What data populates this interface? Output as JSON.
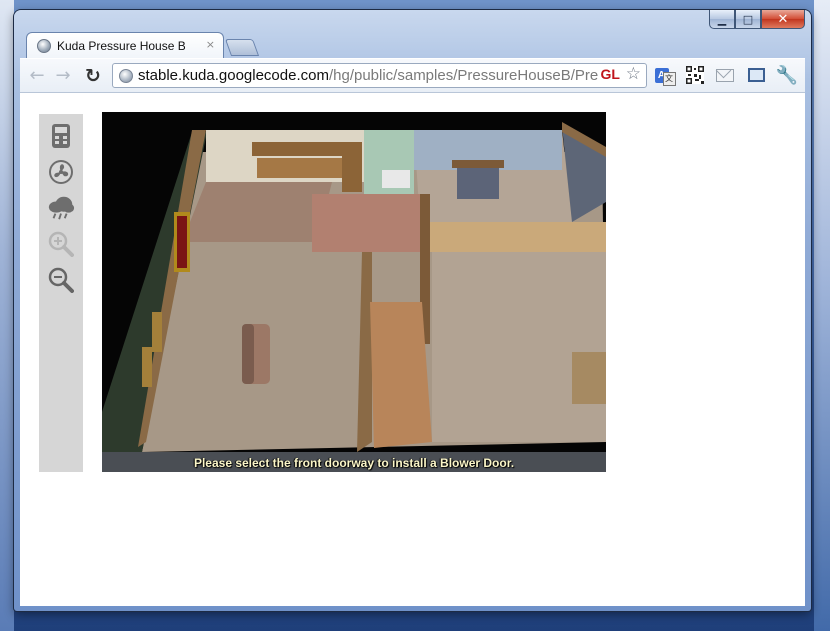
{
  "browser": {
    "tab_title": "Kuda Pressure House B",
    "tab_close": "×",
    "url_host": "stable.kuda.googlecode.com",
    "url_path": "/hg/public/samples/PressureHouseB/Pres",
    "gl_badge": "GL",
    "translate_badge": "A",
    "translate_sub": "文"
  },
  "window_controls": {
    "minimize": "▁",
    "maximize": "□",
    "close": "✕"
  },
  "toolbar_icons": [
    "back-arrow-icon",
    "forward-arrow-icon",
    "reload-icon",
    "star-icon",
    "translate-icon",
    "qr-code-icon",
    "mail-icon",
    "fullscreen-icon",
    "wrench-icon"
  ],
  "tools": [
    "meter-icon",
    "fan-icon",
    "cloud-rain-icon",
    "zoom-in-icon",
    "zoom-out-icon"
  ],
  "scene": {
    "message": "Please select the front doorway to install a Blower Door."
  },
  "colors": {
    "sidebar_bg": "#d6d6d6",
    "caption_text": "#fbf6c8",
    "close_red": "#c1361f"
  }
}
